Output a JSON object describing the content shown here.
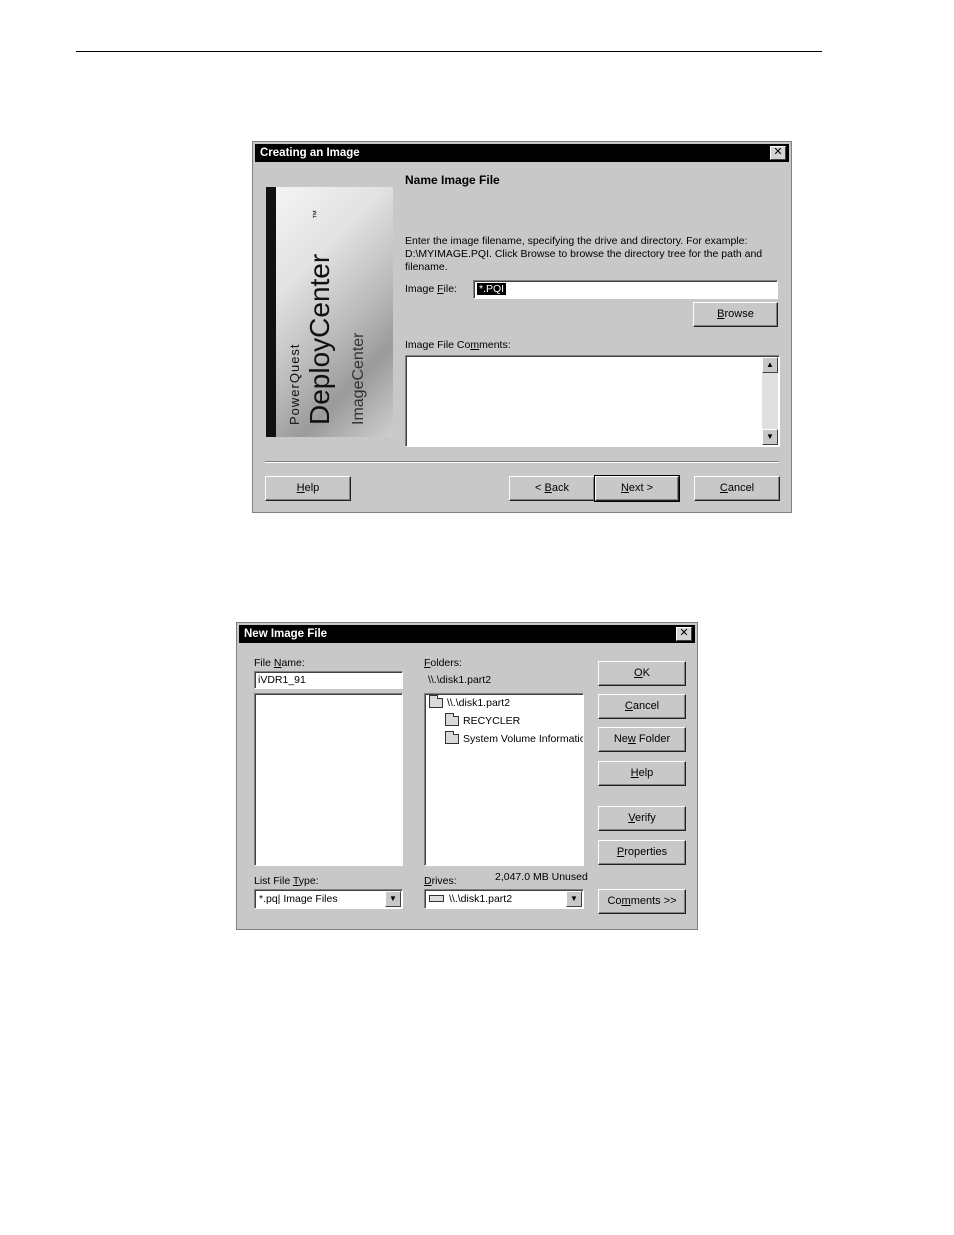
{
  "dialog1": {
    "title": "Creating an Image",
    "close_glyph": "✕",
    "logo": {
      "brand_small": "PowerQuest",
      "brand_large": "DeployCenter",
      "tm": "™",
      "brand_sub": "ImageCenter"
    },
    "heading": "Name Image File",
    "instructions_line1": "Enter the image filename, specifying the drive and directory.  For example:",
    "instructions_line2": "D:\\MYIMAGE.PQI.  Click Browse to browse the directory tree for the path and",
    "instructions_line3": "filename.",
    "image_file_label_pre": "Image ",
    "image_file_label_ul": "F",
    "image_file_label_post": "ile:",
    "image_file_value": "*.PQI",
    "browse_pre": "",
    "browse_ul": "B",
    "browse_post": "rowse",
    "comments_label_pre": "Image File Co",
    "comments_label_ul": "m",
    "comments_label_post": "ments:",
    "comments_value": "",
    "help_ul": "H",
    "help_post": "elp",
    "back_pre": "< ",
    "back_ul": "B",
    "back_post": "ack",
    "next_ul": "N",
    "next_post": "ext >",
    "cancel_ul": "C",
    "cancel_post": "ancel"
  },
  "dialog2": {
    "title": "New Image File",
    "close_glyph": "✕",
    "file_name_label_pre": "File ",
    "file_name_label_ul": "N",
    "file_name_label_post": "ame:",
    "file_name_value": "iVDR1_91",
    "folders_label_ul": "F",
    "folders_label_post": "olders:",
    "current_path": "\\\\.\\disk1.part2",
    "folder_items": [
      "\\\\.\\disk1.part2",
      "RECYCLER",
      "System Volume Informatio"
    ],
    "list_type_label_pre": "List File ",
    "list_type_label_ul": "T",
    "list_type_label_post": "ype:",
    "list_type_value": "*.pq|  Image Files",
    "drives_label_ul": "D",
    "drives_label_post": "rives:",
    "drives_value": "\\\\.\\disk1.part2",
    "unused": "2,047.0 MB Unused",
    "ok_ul": "O",
    "ok_post": "K",
    "cancel_ul": "C",
    "cancel_post": "ancel",
    "newfolder_pre": "Ne",
    "newfolder_ul": "w",
    "newfolder_post": " Folder",
    "help_ul": "H",
    "help_post": "elp",
    "verify_ul": "V",
    "verify_post": "erify",
    "properties_ul": "P",
    "properties_post": "roperties",
    "comments_pre": "Co",
    "comments_ul": "m",
    "comments_post": "ments >>"
  }
}
